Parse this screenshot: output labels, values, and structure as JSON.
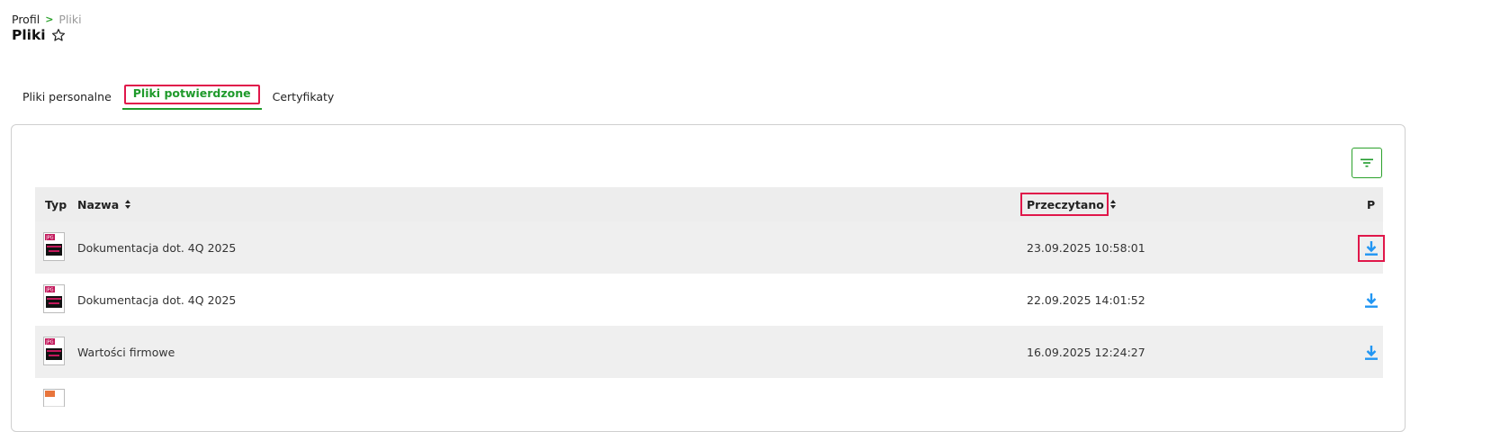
{
  "breadcrumb": {
    "first": "Profil",
    "separator": ">",
    "current": "Pliki"
  },
  "page": {
    "title": "Pliki",
    "favorite_icon": "star-outline-icon"
  },
  "tabs": [
    {
      "label": "Pliki personalne",
      "active": false
    },
    {
      "label": "Pliki potwierdzone",
      "active": true
    },
    {
      "label": "Certyfikaty",
      "active": false
    }
  ],
  "toolbar": {
    "filter_icon": "filter-icon"
  },
  "table": {
    "headers": {
      "type": "Typ",
      "name": "Nazwa",
      "read": "Przeczytano",
      "p": "P"
    },
    "rows": [
      {
        "type": "JPG",
        "name": "Dokumentacja dot. 4Q 2025",
        "read": "23.09.2025 10:58:01"
      },
      {
        "type": "JPG",
        "name": "Dokumentacja dot. 4Q 2025",
        "read": "22.09.2025 14:01:52"
      },
      {
        "type": "JPG",
        "name": "Wartości firmowe",
        "read": "16.09.2025 12:24:27"
      }
    ]
  },
  "colors": {
    "accent_green": "#1f9a2b",
    "highlight_red": "#e0174a",
    "download_blue": "#2196f3",
    "file_pink": "#c2185b"
  }
}
